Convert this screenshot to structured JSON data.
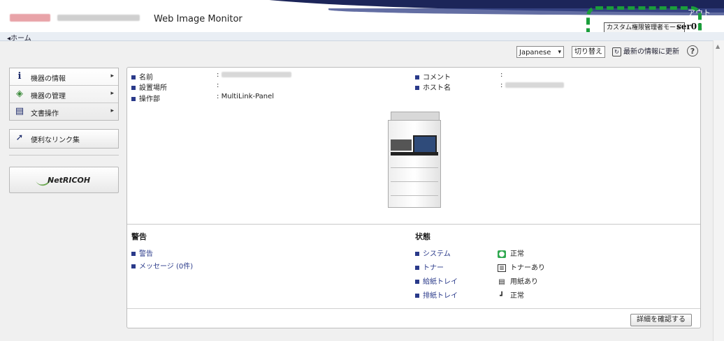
{
  "header": {
    "app_title": "Web Image Monitor",
    "logout_label": "アウト",
    "mode_badge": "カスタム権限管理者モード",
    "user_name": "ser01"
  },
  "breadcrumb": {
    "home": "◂ホーム"
  },
  "toolbar": {
    "language_value": "Japanese",
    "switch_label": "切り替え",
    "refresh_label": "最新の情報に更新",
    "help_label": "?"
  },
  "sidebar": {
    "items": [
      {
        "label": "機器の情報",
        "icon": "info-icon"
      },
      {
        "label": "機器の管理",
        "icon": "device-management-icon"
      },
      {
        "label": "文書操作",
        "icon": "document-icon"
      }
    ],
    "links_label": "便利なリンク集",
    "banner_label": "NetRICOH"
  },
  "device": {
    "name_label": "名前",
    "location_label": "設置場所",
    "operation_label": "操作部",
    "operation_value": "MultiLink-Panel",
    "comment_label": "コメント",
    "host_label": "ホスト名",
    "colon": ":"
  },
  "alerts": {
    "title": "警告",
    "links": [
      "警告",
      "メッセージ (0件)"
    ]
  },
  "status": {
    "title": "状態",
    "rows": [
      {
        "label": "システム",
        "value": "正常",
        "icon": "system-ok-icon"
      },
      {
        "label": "トナー",
        "value": "トナーあり",
        "icon": "toner-icon"
      },
      {
        "label": "給紙トレイ",
        "value": "用紙あり",
        "icon": "paper-tray-icon"
      },
      {
        "label": "排紙トレイ",
        "value": "正常",
        "icon": "output-tray-icon"
      }
    ]
  },
  "detail_button": "詳細を確認する",
  "colors": {
    "accent_navy": "#1c2559",
    "highlight_green": "#1a9e3a",
    "link_blue": "#2a3a8a"
  }
}
